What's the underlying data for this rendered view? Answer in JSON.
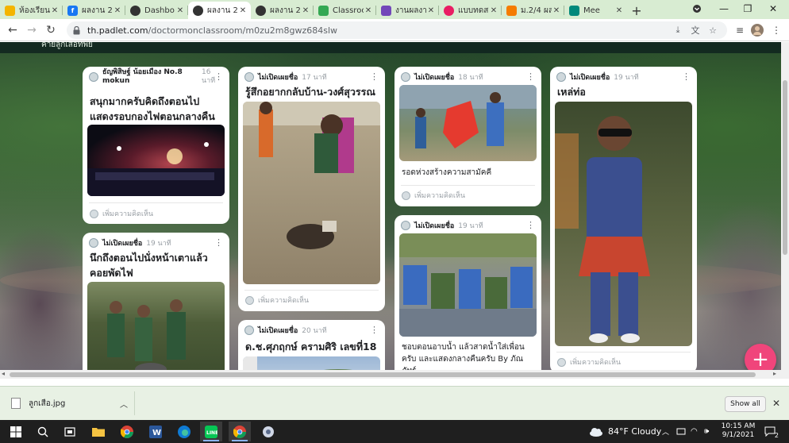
{
  "browser": {
    "tabs": [
      {
        "label": "ห้องเรียน",
        "favicon": "slides-icon",
        "color": "#f4b400"
      },
      {
        "label": "ผลงาน 2",
        "favicon": "facebook-icon",
        "color": "#1877f2"
      },
      {
        "label": "Dashbo",
        "favicon": "padlet-icon",
        "color": "#333333"
      },
      {
        "label": "ผลงาน 2",
        "favicon": "padlet-icon",
        "color": "#333333"
      },
      {
        "label": "ผลงาน 2",
        "favicon": "padlet-icon",
        "color": "#333333"
      },
      {
        "label": "Classroo",
        "favicon": "classroom-icon",
        "color": "#34a853"
      },
      {
        "label": "งานผลงาน",
        "favicon": "forms-icon",
        "color": "#7248b9"
      },
      {
        "label": "แบบทดส",
        "favicon": "heart-icon",
        "color": "#e91e63"
      },
      {
        "label": "ม.2/4 ผลง",
        "favicon": "orange-icon",
        "color": "#f57c00"
      },
      {
        "label": "Mee",
        "favicon": "meet-icon",
        "color": "#00897b"
      }
    ],
    "active_tab_index": 3,
    "url_host": "th.padlet.com",
    "url_path": "/doctormonclassroom/m0zu2m8gwz684slw"
  },
  "padlet": {
    "header_partial": "ค่ายลูกเสือทัพย์",
    "cards": [
      {
        "author": "ธัญพิสิษฐ์ น้อยเมือง No.8 mokun",
        "time": "16 นาที",
        "title": "สนุกมากครับคิดถึงตอนไปแสดงรอบกองไฟตอนกลางคืน",
        "body": "",
        "comment_label": "เพิ่มความคิดเห็น"
      },
      {
        "author": "ไม่เปิดเผยชื่อ",
        "time": "19 นาที",
        "title": "นึกถึงตอนไปนั่งหน้าเตาแล้วคอยพัดไฟ",
        "body": "",
        "comment_label": ""
      },
      {
        "author": "ไม่เปิดเผยชื่อ",
        "time": "17 นาที",
        "title": "รู้สึกอยากกลับบ้าน-วงศ์สุวรรณ",
        "body": "",
        "comment_label": "เพิ่มความคิดเห็น"
      },
      {
        "author": "ไม่เปิดเผยชื่อ",
        "time": "20 นาที",
        "title": "ด.ช.ศุภฤกษ์ ครามศิริ เลขที่18",
        "body": "",
        "comment_label": ""
      },
      {
        "author": "ไม่เปิดเผยชื่อ",
        "time": "18 นาที",
        "title": "",
        "body": "รอดห่วงสร้างความสามัคคี",
        "comment_label": "เพิ่มความคิดเห็น"
      },
      {
        "author": "ไม่เปิดเผยชื่อ",
        "time": "19 นาที",
        "title": "",
        "body": "ชอบตอนอาบน้ำ แล้วสาดน้ำใส่เพื่อนครับ และแสดงกลางคืนครับ By ภัณภัทร์",
        "comment_label": ""
      },
      {
        "author": "ไม่เปิดเผยชื่อ",
        "time": "19 นาที",
        "title": "เหล่ท่อ",
        "body": "",
        "comment_label": "เพิ่มความคิดเห็น"
      }
    ],
    "fab_label": "+"
  },
  "downloads": {
    "file_name": "ลูกเสือ.jpg",
    "show_all_label": "Show all"
  },
  "taskbar": {
    "weather": "84°F  Cloudy",
    "time": "10:15 AM",
    "date": "9/1/2021",
    "notification_count": "2"
  },
  "colors": {
    "tabstrip": "#d8ecd2",
    "fab": "#f0457b",
    "taskbar": "#1f1f1f"
  }
}
